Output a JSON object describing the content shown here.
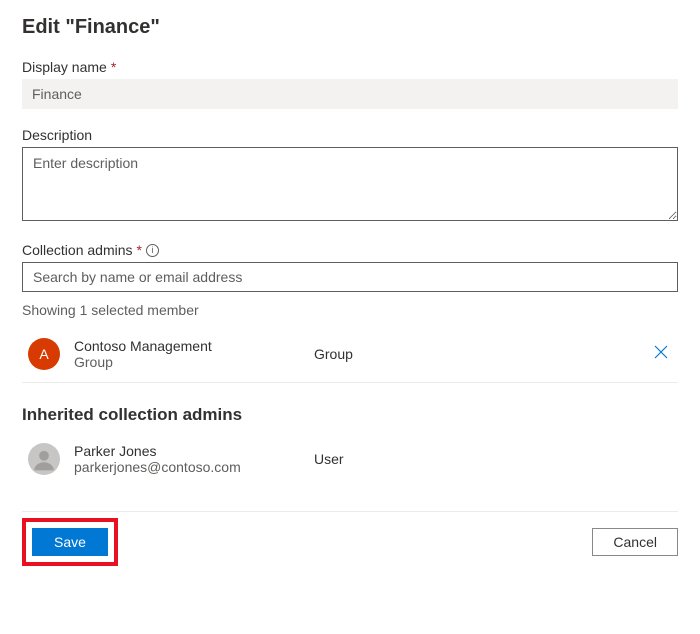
{
  "page_title": "Edit \"Finance\"",
  "display_name": {
    "label": "Display name",
    "value": "Finance"
  },
  "description": {
    "label": "Description",
    "placeholder": "Enter description",
    "value": ""
  },
  "admins": {
    "label": "Collection admins",
    "search_placeholder": "Search by name or email address",
    "status_text": "Showing 1 selected member",
    "selected": {
      "avatar_letter": "A",
      "name": "Contoso Management",
      "subtext": "Group",
      "type": "Group"
    }
  },
  "inherited": {
    "heading": "Inherited collection admins",
    "member": {
      "name": "Parker Jones",
      "subtext": "parkerjones@contoso.com",
      "type": "User"
    }
  },
  "buttons": {
    "save": "Save",
    "cancel": "Cancel"
  }
}
